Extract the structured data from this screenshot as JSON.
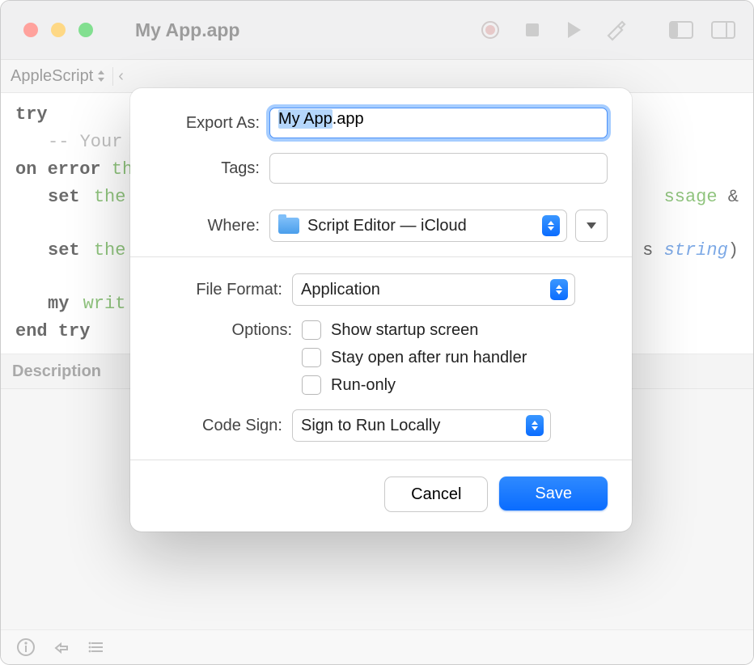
{
  "window": {
    "title": "My App.app",
    "language": "AppleScript"
  },
  "code": {
    "line1_a": "try",
    "line2_a": "-- Your",
    "line3_a": "on error",
    "line3_b": "the",
    "line4_a": "set",
    "line4_b": "the",
    "line4_c": "ssage",
    "line4_d": " &",
    "line5_a": "set",
    "line5_b": "the",
    "line5_c": "s ",
    "line5_d": "string",
    "line5_e": ")",
    "line6_a": "my",
    "line6_b": "writ",
    "line7_a": "end try"
  },
  "sidebar": {
    "description_label": "Description"
  },
  "sheet": {
    "export_as_label": "Export As:",
    "export_as_value_selected": "My App",
    "export_as_value_rest": ".app",
    "tags_label": "Tags:",
    "tags_value": "",
    "where_label": "Where:",
    "where_value": "Script Editor — iCloud",
    "file_format_label": "File Format:",
    "file_format_value": "Application",
    "options_label": "Options:",
    "option1": "Show startup screen",
    "option2": "Stay open after run handler",
    "option3": "Run-only",
    "code_sign_label": "Code Sign:",
    "code_sign_value": "Sign to Run Locally",
    "cancel_label": "Cancel",
    "save_label": "Save"
  }
}
